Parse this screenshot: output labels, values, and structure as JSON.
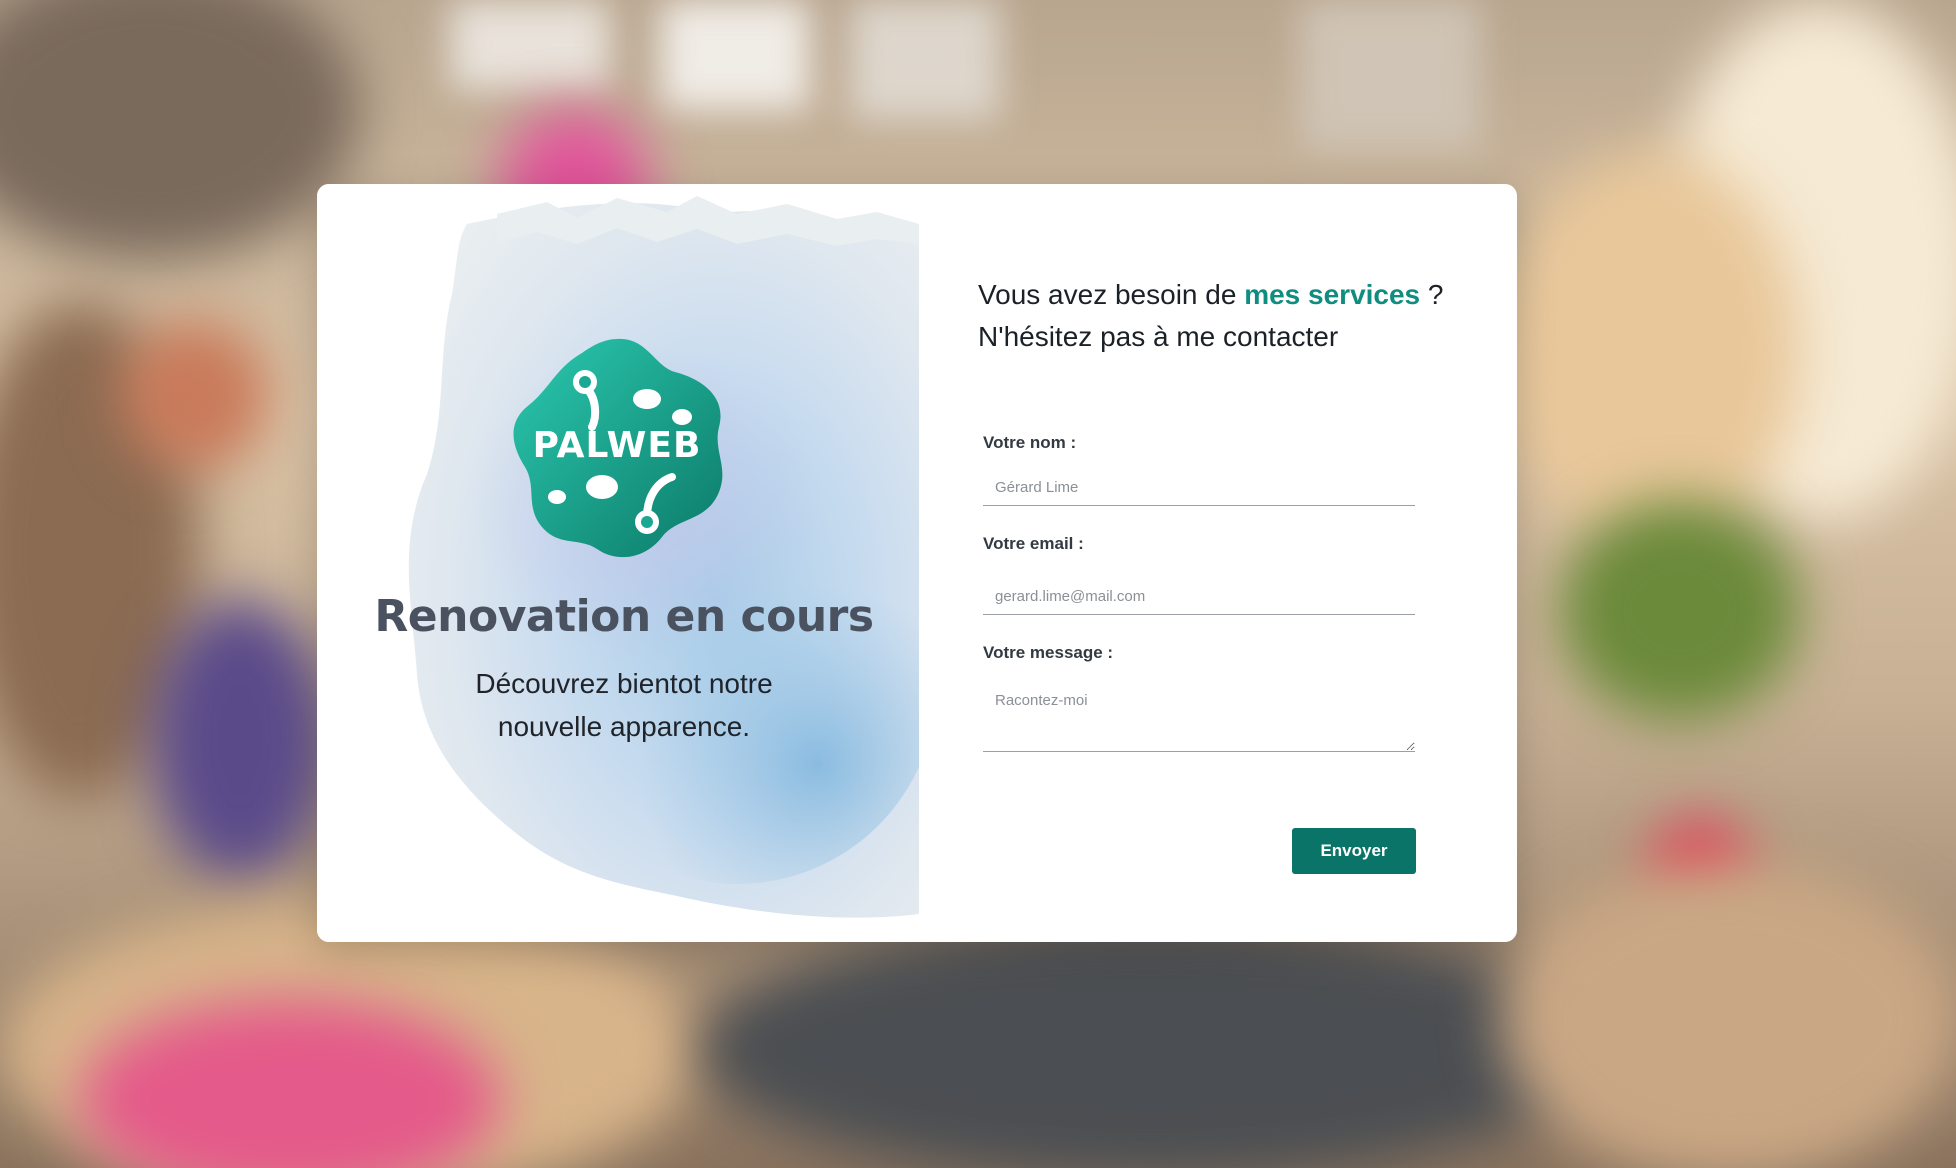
{
  "brand": {
    "logo_text": "PALWEB",
    "accent_color": "#0f8d80",
    "button_color": "#0b7469"
  },
  "left": {
    "heading": "Renovation en cours",
    "subtext_line1": "Découvrez bientot notre",
    "subtext_line2": "nouvelle apparence."
  },
  "right": {
    "intro_before": "Vous avez besoin de ",
    "intro_accent": "mes services",
    "intro_after": " ?",
    "intro_line2": "N'hésitez pas à me contacter"
  },
  "form": {
    "name_label": "Votre nom :",
    "name_placeholder": "Gérard Lime",
    "email_label": "Votre email :",
    "email_placeholder": "gerard.lime@mail.com",
    "message_label": "Votre message :",
    "message_placeholder": "Racontez-moi",
    "submit_label": "Envoyer"
  }
}
